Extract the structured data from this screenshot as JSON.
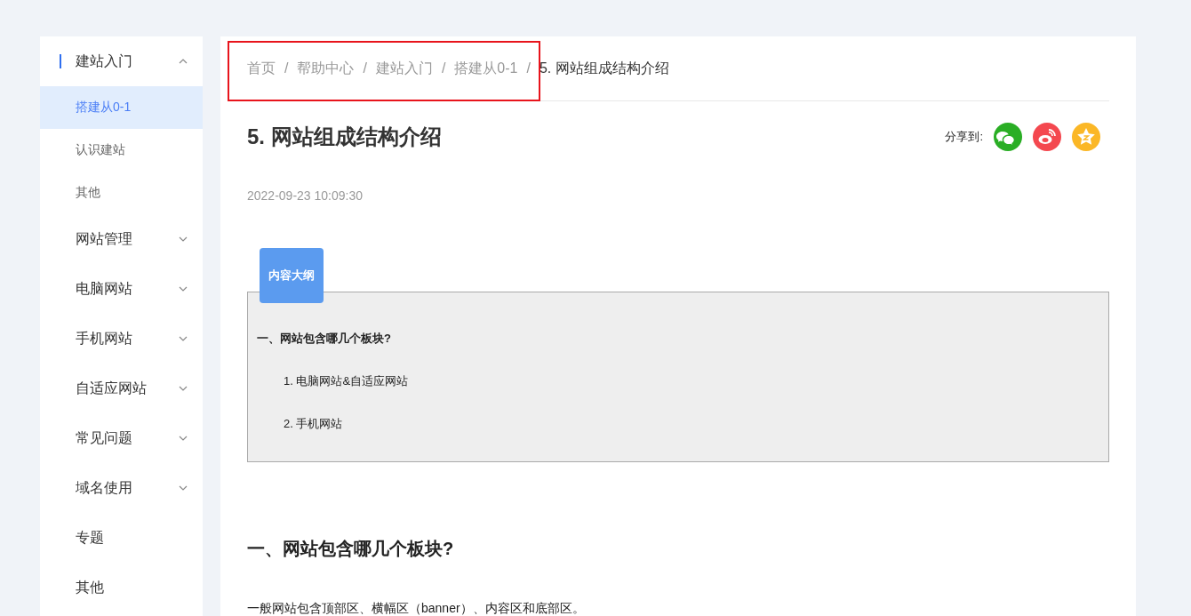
{
  "sidebar": {
    "items": [
      {
        "label": "建站入门",
        "kind": "group",
        "expanded": true,
        "children": [
          {
            "label": "搭建从0-1",
            "selected": true
          },
          {
            "label": "认识建站",
            "selected": false
          },
          {
            "label": "其他",
            "selected": false
          }
        ]
      },
      {
        "label": "网站管理",
        "kind": "group",
        "expanded": false
      },
      {
        "label": "电脑网站",
        "kind": "group",
        "expanded": false
      },
      {
        "label": "手机网站",
        "kind": "group",
        "expanded": false
      },
      {
        "label": "自适应网站",
        "kind": "group",
        "expanded": false
      },
      {
        "label": "常见问题",
        "kind": "group",
        "expanded": false
      },
      {
        "label": "域名使用",
        "kind": "group",
        "expanded": false
      },
      {
        "label": "专题",
        "kind": "link"
      },
      {
        "label": "其他",
        "kind": "link"
      }
    ]
  },
  "breadcrumb": {
    "items": [
      {
        "label": "首页",
        "current": false
      },
      {
        "label": "帮助中心",
        "current": false
      },
      {
        "label": "建站入门",
        "current": false
      },
      {
        "label": "搭建从0-1",
        "current": false
      },
      {
        "label": "5. 网站组成结构介绍",
        "current": true
      }
    ],
    "separators": [
      "/",
      "/",
      "/",
      "/"
    ]
  },
  "article": {
    "title": "5. 网站组成结构介绍",
    "date": "2022-09-23 10:09:30",
    "share": {
      "label": "分享到:",
      "buttons": [
        {
          "kind": "chat"
        },
        {
          "kind": "swirl"
        },
        {
          "kind": "star"
        }
      ]
    },
    "outline": {
      "tab": "内容大纲",
      "heading": "一、网站包含哪几个板块?",
      "items": [
        "1. 电脑网站&自适应网站",
        "2. 手机网站"
      ]
    },
    "sections": [
      {
        "heading": "一、网站包含哪几个板块?",
        "paragraph": "一般网站包含顶部区、横幅区（banner）、内容区和底部区。"
      }
    ]
  }
}
